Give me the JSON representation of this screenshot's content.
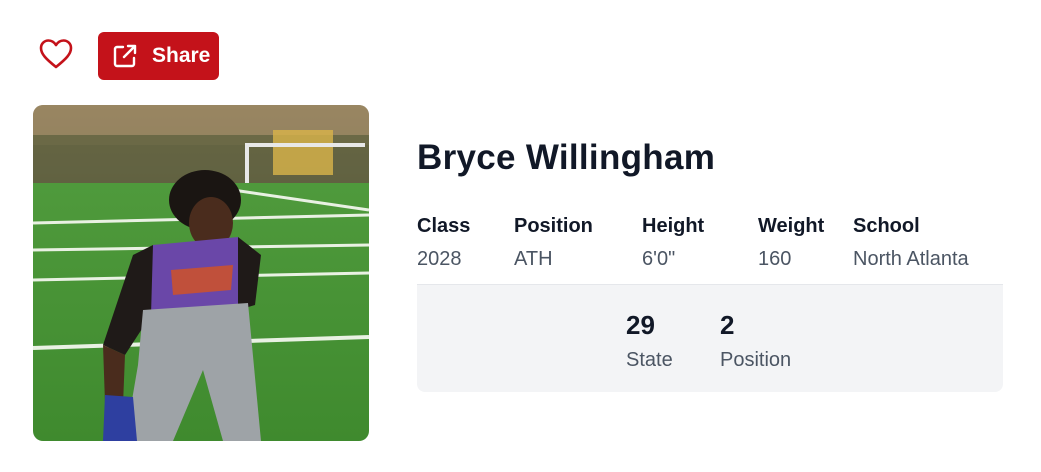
{
  "actions": {
    "favorite_icon": "heart-icon",
    "share_label": "Share",
    "share_icon": "external-link-icon",
    "accent_color": "#c4121a"
  },
  "player": {
    "name": "Bryce Willingham",
    "photo": "player-photo"
  },
  "stats": [
    {
      "label": "Class",
      "value": "2028"
    },
    {
      "label": "Position",
      "value": "ATH"
    },
    {
      "label": "Height",
      "value": "6'0\""
    },
    {
      "label": "Weight",
      "value": "160"
    },
    {
      "label": "School",
      "value": "North Atlanta"
    }
  ],
  "rankings": [
    {
      "number": "29",
      "label": "State"
    },
    {
      "number": "2",
      "label": "Position"
    }
  ]
}
